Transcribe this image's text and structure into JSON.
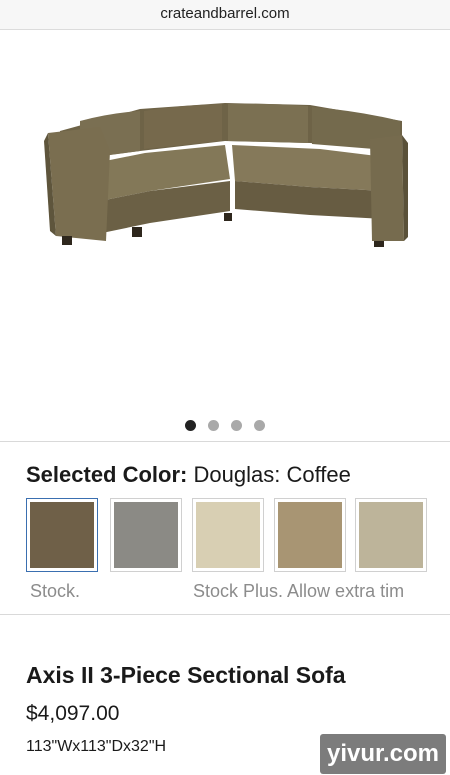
{
  "browser": {
    "url": "crateandbarrel.com"
  },
  "gallery": {
    "image_alt": "Axis II 3-Piece Sectional Sofa",
    "dots": [
      true,
      false,
      false,
      false
    ]
  },
  "color_picker": {
    "label": "Selected Color:",
    "value": "Douglas: Coffee",
    "swatches": [
      {
        "color": "#6f6048",
        "selected": true
      },
      {
        "color": "#8b8a85",
        "selected": false
      },
      {
        "color": "#d8cfb3",
        "selected": false
      },
      {
        "color": "#a89573",
        "selected": false
      },
      {
        "color": "#bdb49a",
        "selected": false
      }
    ],
    "stock_note": "Stock.",
    "stock_plus_note": "Stock Plus. Allow extra tim"
  },
  "product": {
    "name": "Axis II 3-Piece Sectional Sofa",
    "price": "$4,097.00",
    "dimensions": "113\"Wx113\"Dx32\"H"
  },
  "watermark": "yivur.com"
}
